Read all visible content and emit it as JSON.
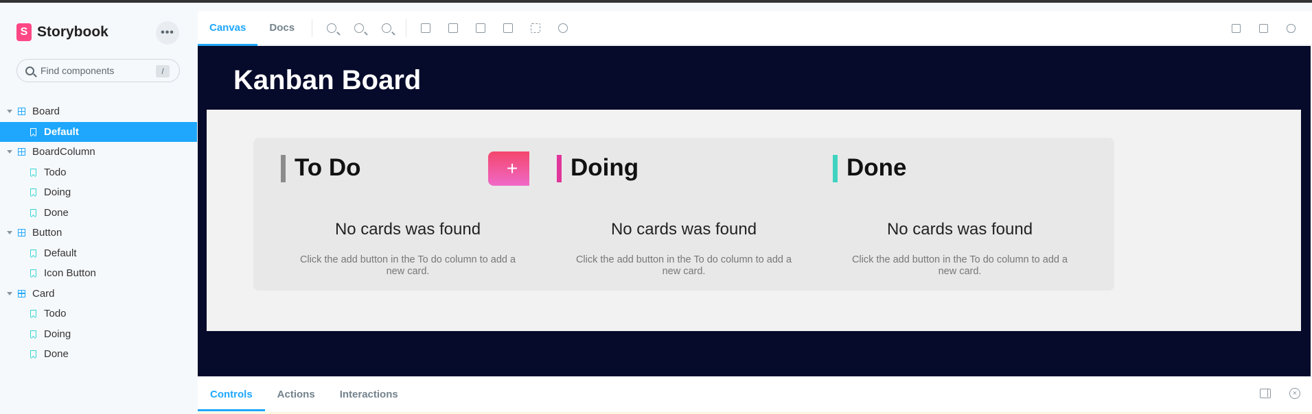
{
  "sidebar": {
    "brand": "Storybook",
    "brand_logo": "S",
    "menu_label": "•••",
    "search": {
      "placeholder": "Find components",
      "shortcut": "/"
    },
    "tree": [
      {
        "label": "Board",
        "kind": "group"
      },
      {
        "label": "Default",
        "kind": "story",
        "active": true
      },
      {
        "label": "BoardColumn",
        "kind": "group"
      },
      {
        "label": "Todo",
        "kind": "story"
      },
      {
        "label": "Doing",
        "kind": "story"
      },
      {
        "label": "Done",
        "kind": "story"
      },
      {
        "label": "Button",
        "kind": "group"
      },
      {
        "label": "Default",
        "kind": "story"
      },
      {
        "label": "Icon Button",
        "kind": "story"
      },
      {
        "label": "Card",
        "kind": "group"
      },
      {
        "label": "Todo",
        "kind": "story"
      },
      {
        "label": "Doing",
        "kind": "story"
      },
      {
        "label": "Done",
        "kind": "story"
      }
    ]
  },
  "toolbar": {
    "tabs": [
      "Canvas",
      "Docs"
    ],
    "active_tab": "Canvas",
    "tools": [
      "zoom-in-icon",
      "zoom-out-icon",
      "zoom-reset-icon",
      "background-icon",
      "grid-icon",
      "viewport-icon",
      "measure-icon",
      "outline-icon",
      "remount-icon"
    ],
    "right_tools": [
      "fullscreen-icon",
      "open-new-tab-icon",
      "copy-link-icon"
    ]
  },
  "canvas": {
    "title": "Kanban Board",
    "columns": [
      {
        "title": "To Do",
        "accent": "#8c8c8c",
        "has_add": true,
        "add_label": "+",
        "empty_title": "No cards was found",
        "empty_desc": "Click the add button in the To do column to add a new card."
      },
      {
        "title": "Doing",
        "accent": "#e0359a",
        "has_add": false,
        "empty_title": "No cards was found",
        "empty_desc": "Click the add button in the To do column to add a new card."
      },
      {
        "title": "Done",
        "accent": "#3fd3c0",
        "has_add": false,
        "empty_title": "No cards was found",
        "empty_desc": "Click the add button in the To do column to add a new card."
      }
    ]
  },
  "addons": {
    "tabs": [
      "Controls",
      "Actions",
      "Interactions"
    ],
    "active_tab": "Controls",
    "close_label": "×"
  },
  "colors": {
    "accent": "#1ea7fd",
    "brand": "#ff4785",
    "canvas_bg": "#060a2b"
  }
}
